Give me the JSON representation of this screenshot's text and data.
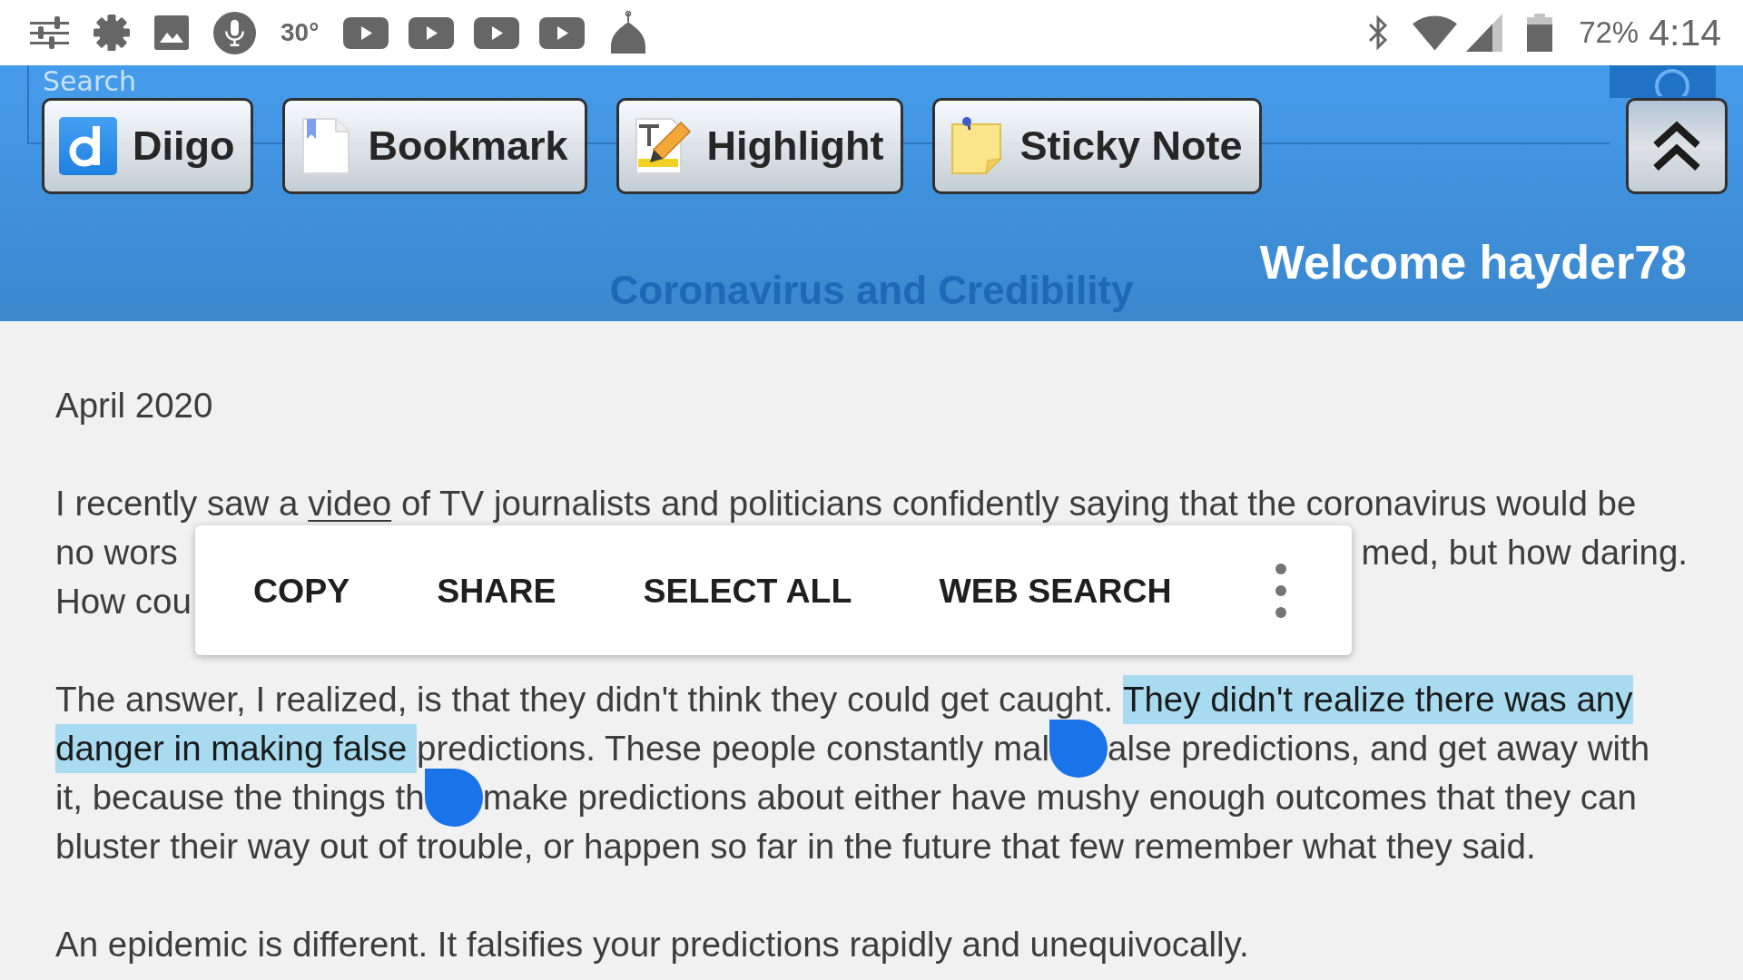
{
  "status_bar": {
    "temperature": "30°",
    "battery": "72%",
    "time": "4:14"
  },
  "header": {
    "search": {
      "placeholder": "Search"
    },
    "toolbar": [
      {
        "kind": "diigo",
        "label": "Diigo"
      },
      {
        "kind": "bookmark",
        "label": "Bookmark"
      },
      {
        "kind": "highlight",
        "label": "Highlight"
      },
      {
        "kind": "sticky_note",
        "label": "Sticky Note"
      }
    ],
    "welcome": "Welcome hayder78",
    "title": "Coronavirus and Credibility"
  },
  "article": {
    "date": "April 2020",
    "paragraphs": [
      {
        "lines": [
          {
            "parts": [
              {
                "kind": "text",
                "text": "I recently saw a ",
                "selected": false
              },
              {
                "kind": "link",
                "text": "video",
                "selected": false
              },
              {
                "kind": "text",
                "text": " of TV journalists and politicians confidently saying that the coronavirus would be",
                "selected": false
              }
            ]
          },
          {
            "parts": [
              {
                "kind": "text",
                "text": "no wors",
                "selected": false
              },
              {
                "kind": "covered"
              },
              {
                "kind": "text",
                "text": "med, but how daring.",
                "selected": false
              }
            ]
          },
          {
            "parts": [
              {
                "kind": "text",
                "text": "How cou",
                "selected": false
              }
            ]
          }
        ]
      },
      {
        "lines": [
          {
            "parts": [
              {
                "kind": "text",
                "text": "The answer, I realized, is that they didn't think they could get caught. ",
                "selected": false
              },
              {
                "kind": "text",
                "text": "They didn't realize there was any",
                "selected": true
              }
            ]
          },
          {
            "parts": [
              {
                "kind": "text",
                "text": "danger in making false ",
                "selected": true
              },
              {
                "kind": "text",
                "text": "predictions. These people constantly mal",
                "selected": false
              },
              {
                "kind": "handle"
              },
              {
                "kind": "text",
                "text": "alse predictions, and get away with",
                "selected": false
              }
            ]
          },
          {
            "parts": [
              {
                "kind": "text",
                "text": "it, because the things th",
                "selected": false
              },
              {
                "kind": "handle"
              },
              {
                "kind": "text",
                "text": "make predictions about either have mushy enough outcomes that they can",
                "selected": false
              }
            ]
          },
          {
            "parts": [
              {
                "kind": "text",
                "text": "bluster their way out of trouble, or happen so far in the future that few remember what they said.",
                "selected": false
              }
            ]
          }
        ]
      },
      {
        "lines": [
          {
            "parts": [
              {
                "kind": "text",
                "text": "An epidemic is different. It falsifies your predictions rapidly and unequivocally.",
                "selected": false
              }
            ]
          }
        ]
      }
    ]
  },
  "context_menu": {
    "items": [
      "COPY",
      "SHARE",
      "SELECT ALL",
      "WEB SEARCH"
    ]
  }
}
